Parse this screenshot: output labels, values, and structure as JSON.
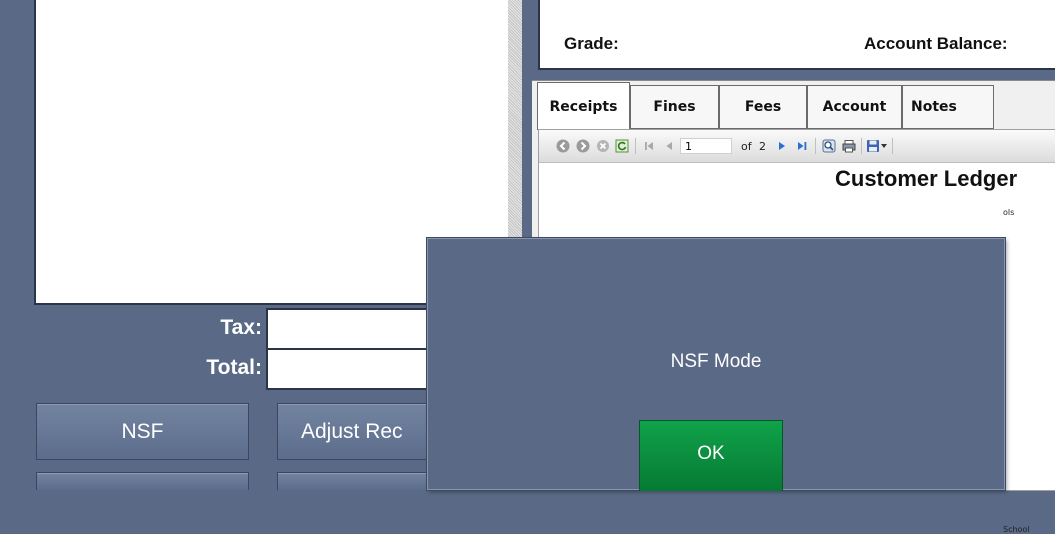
{
  "summary": {
    "tax_label": "Tax:",
    "tax_value": "",
    "total_label": "Total:",
    "total_value": ""
  },
  "actions": {
    "nsf_label": "NSF",
    "adjust_label": "Adjust Rec"
  },
  "customer": {
    "grade_label": "Grade:",
    "balance_label": "Account Balance:"
  },
  "tabs": [
    {
      "label": "Receipts",
      "active": true
    },
    {
      "label": "Fines",
      "active": false
    },
    {
      "label": "Fees",
      "active": false
    },
    {
      "label": "Account",
      "active": false
    },
    {
      "label": "Notes",
      "active": false
    }
  ],
  "report": {
    "page_current": "1",
    "page_of": "of",
    "page_total": "2",
    "title": "Customer Ledger",
    "fragment_1": "ols",
    "fragment_2": "School"
  },
  "dialog": {
    "message": "NSF Mode",
    "ok_label": "OK"
  },
  "colors": {
    "panel_bg": "#5a6a86",
    "ok_green": "#0a8f3f",
    "tab_border": "#6b6b6b"
  }
}
